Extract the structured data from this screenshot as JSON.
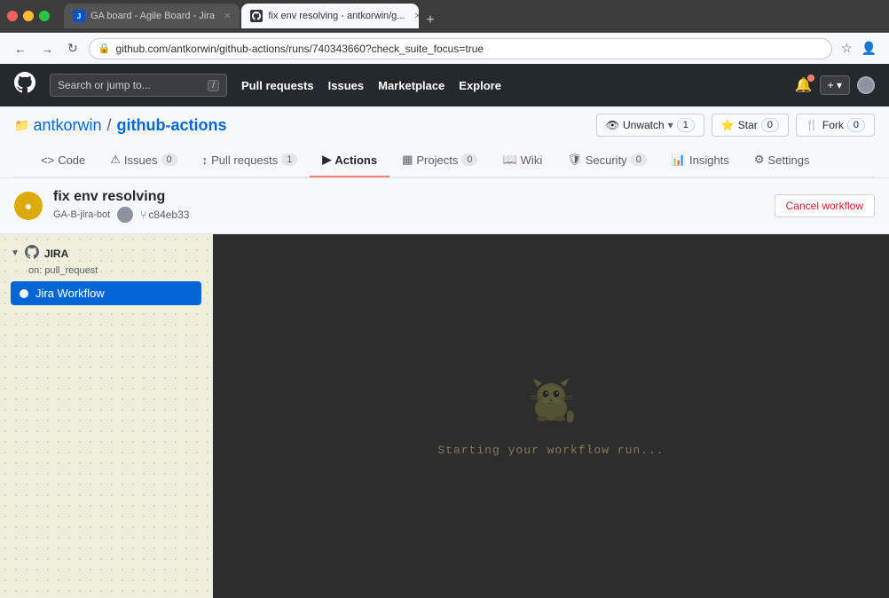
{
  "browser": {
    "tabs": [
      {
        "id": "tab-jira",
        "label": "GA board - Agile Board - Jira",
        "favicon_type": "jira",
        "active": false
      },
      {
        "id": "tab-github",
        "label": "fix env resolving - antkorwin/g...",
        "favicon_type": "github",
        "active": true
      }
    ],
    "add_tab_label": "+",
    "url": "github.com/antkorwin/github-actions/runs/740343660?check_suite_focus=true",
    "nav": {
      "back": "←",
      "forward": "→",
      "refresh": "↻"
    }
  },
  "github": {
    "header": {
      "search_placeholder": "Search or jump to...",
      "search_kbd": "/",
      "nav_items": [
        "Pull requests",
        "Issues",
        "Marketplace",
        "Explore"
      ],
      "logo": "🐙"
    },
    "repo": {
      "owner": "antkorwin",
      "separator": "/",
      "name": "github-actions",
      "actions": {
        "unwatch_label": "Unwatch",
        "unwatch_count": "1",
        "star_label": "Star",
        "star_count": "0",
        "fork_label": "Fork",
        "fork_count": "0"
      }
    },
    "tabs": [
      {
        "id": "code",
        "label": "Code",
        "badge": null,
        "active": false
      },
      {
        "id": "issues",
        "label": "Issues",
        "badge": "0",
        "active": false
      },
      {
        "id": "pull-requests",
        "label": "Pull requests",
        "badge": "1",
        "active": false
      },
      {
        "id": "actions",
        "label": "Actions",
        "badge": null,
        "active": true
      },
      {
        "id": "projects",
        "label": "Projects",
        "badge": "0",
        "active": false
      },
      {
        "id": "wiki",
        "label": "Wiki",
        "badge": null,
        "active": false
      },
      {
        "id": "security",
        "label": "Security",
        "badge": "0",
        "active": false
      },
      {
        "id": "insights",
        "label": "Insights",
        "badge": null,
        "active": false
      },
      {
        "id": "settings",
        "label": "Settings",
        "badge": null,
        "active": false
      }
    ],
    "workflow_run": {
      "title": "fix env resolving",
      "bot_name": "GA-B-jira-bot",
      "sha": "c84eb33",
      "cancel_button_label": "Cancel workflow",
      "status": "pending"
    },
    "sidebar": {
      "group_name": "JIRA",
      "group_trigger": "on: pull_request",
      "jobs": [
        {
          "id": "jira-workflow",
          "label": "Jira Workflow",
          "status": "running",
          "active": true
        }
      ]
    },
    "main_panel": {
      "status_text": "Starting your workflow run..."
    }
  }
}
